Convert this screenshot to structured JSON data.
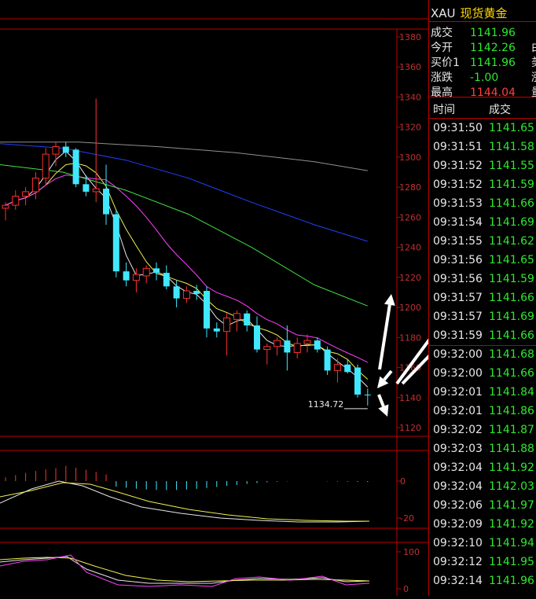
{
  "header": {
    "symbol": "XAU",
    "name": "现货黄金"
  },
  "quote": [
    {
      "label": "成交",
      "value": "1141.96",
      "color": "#2ee82e"
    },
    {
      "label": "今开",
      "value": "1142.26",
      "color": "#2ee82e",
      "cut": "由"
    },
    {
      "label": "买价1",
      "value": "1141.96",
      "color": "#2ee82e",
      "cut": "美"
    },
    {
      "label": "涨跌",
      "value": "-1.00",
      "color": "#2ee82e",
      "cut": "涨"
    },
    {
      "label": "最高",
      "value": "1144.04",
      "color": "#ff4040",
      "cut": "量"
    }
  ],
  "ticks_header": {
    "time": "时间",
    "price": "成交"
  },
  "ticks": [
    {
      "time": "09:31:50",
      "price": "1141.65"
    },
    {
      "time": "09:31:51",
      "price": "1141.58"
    },
    {
      "time": "09:31:52",
      "price": "1141.55"
    },
    {
      "time": "09:31:52",
      "price": "1141.59"
    },
    {
      "time": "09:31:53",
      "price": "1141.66"
    },
    {
      "time": "09:31:54",
      "price": "1141.69"
    },
    {
      "time": "09:31:55",
      "price": "1141.62"
    },
    {
      "time": "09:31:56",
      "price": "1141.65"
    },
    {
      "time": "09:31:56",
      "price": "1141.59"
    },
    {
      "time": "09:31:57",
      "price": "1141.66"
    },
    {
      "time": "09:31:57",
      "price": "1141.69"
    },
    {
      "time": "09:31:59",
      "price": "1141.66"
    },
    {
      "time": "09:32:00",
      "price": "1141.68"
    },
    {
      "time": "09:32:00",
      "price": "1141.66"
    },
    {
      "time": "09:32:01",
      "price": "1141.84"
    },
    {
      "time": "09:32:01",
      "price": "1141.86"
    },
    {
      "time": "09:32:02",
      "price": "1141.87"
    },
    {
      "time": "09:32:03",
      "price": "1141.88"
    },
    {
      "time": "09:32:04",
      "price": "1141.92"
    },
    {
      "time": "09:32:04",
      "price": "1142.03"
    },
    {
      "time": "09:32:06",
      "price": "1141.97"
    },
    {
      "time": "09:32:09",
      "price": "1141.92"
    },
    {
      "time": "09:32:10",
      "price": "1141.94"
    },
    {
      "time": "09:32:12",
      "price": "1141.95"
    },
    {
      "time": "09:32:14",
      "price": "1141.96"
    }
  ],
  "colors": {
    "up": "#ff3030",
    "down": "#40e8ff",
    "grid": "#c00000",
    "axis_text": "#c03030",
    "tick_price": "#2ee82e",
    "ma1": "#e8e8e8",
    "ma2": "#f0f050",
    "ma3": "#ff40ff",
    "ma4": "#40e040",
    "ma5": "#2040ff",
    "ma6": "#909090"
  },
  "chart_data": [
    {
      "type": "candlestick",
      "yticks": [
        1120,
        1140,
        1160,
        1180,
        1200,
        1220,
        1240,
        1260,
        1280,
        1300,
        1320,
        1340,
        1360,
        1380
      ],
      "ylim": [
        1116,
        1384
      ],
      "annotation": "1134.72",
      "candles": [
        {
          "o": 1266,
          "h": 1270,
          "l": 1258,
          "c": 1268
        },
        {
          "o": 1268,
          "h": 1278,
          "l": 1265,
          "c": 1274
        },
        {
          "o": 1274,
          "h": 1280,
          "l": 1268,
          "c": 1277
        },
        {
          "o": 1277,
          "h": 1290,
          "l": 1272,
          "c": 1286
        },
        {
          "o": 1286,
          "h": 1306,
          "l": 1282,
          "c": 1302
        },
        {
          "o": 1302,
          "h": 1310,
          "l": 1294,
          "c": 1307
        },
        {
          "o": 1307,
          "h": 1310,
          "l": 1300,
          "c": 1303
        },
        {
          "o": 1305,
          "h": 1306,
          "l": 1280,
          "c": 1282
        },
        {
          "o": 1282,
          "h": 1288,
          "l": 1274,
          "c": 1277
        },
        {
          "o": 1277,
          "h": 1339,
          "l": 1270,
          "c": 1279
        },
        {
          "o": 1279,
          "h": 1295,
          "l": 1255,
          "c": 1262
        },
        {
          "o": 1262,
          "h": 1265,
          "l": 1220,
          "c": 1224
        },
        {
          "o": 1224,
          "h": 1230,
          "l": 1214,
          "c": 1218
        },
        {
          "o": 1218,
          "h": 1226,
          "l": 1210,
          "c": 1222
        },
        {
          "o": 1221,
          "h": 1228,
          "l": 1216,
          "c": 1226
        },
        {
          "o": 1226,
          "h": 1230,
          "l": 1218,
          "c": 1223
        },
        {
          "o": 1223,
          "h": 1228,
          "l": 1212,
          "c": 1214
        },
        {
          "o": 1214,
          "h": 1218,
          "l": 1200,
          "c": 1206
        },
        {
          "o": 1206,
          "h": 1214,
          "l": 1203,
          "c": 1211
        },
        {
          "o": 1211,
          "h": 1215,
          "l": 1205,
          "c": 1209
        },
        {
          "o": 1211,
          "h": 1214,
          "l": 1180,
          "c": 1186
        },
        {
          "o": 1186,
          "h": 1190,
          "l": 1180,
          "c": 1184
        },
        {
          "o": 1184,
          "h": 1196,
          "l": 1168,
          "c": 1193
        },
        {
          "o": 1192,
          "h": 1198,
          "l": 1184,
          "c": 1196
        },
        {
          "o": 1196,
          "h": 1198,
          "l": 1184,
          "c": 1188
        },
        {
          "o": 1188,
          "h": 1194,
          "l": 1170,
          "c": 1172
        },
        {
          "o": 1172,
          "h": 1176,
          "l": 1162,
          "c": 1174
        },
        {
          "o": 1174,
          "h": 1180,
          "l": 1168,
          "c": 1178
        },
        {
          "o": 1178,
          "h": 1188,
          "l": 1158,
          "c": 1170
        },
        {
          "o": 1170,
          "h": 1180,
          "l": 1166,
          "c": 1176
        },
        {
          "o": 1176,
          "h": 1182,
          "l": 1170,
          "c": 1178
        },
        {
          "o": 1178,
          "h": 1180,
          "l": 1170,
          "c": 1172
        },
        {
          "o": 1172,
          "h": 1174,
          "l": 1155,
          "c": 1158
        },
        {
          "o": 1158,
          "h": 1166,
          "l": 1150,
          "c": 1162
        },
        {
          "o": 1162,
          "h": 1165,
          "l": 1156,
          "c": 1157
        },
        {
          "o": 1160,
          "h": 1162,
          "l": 1140,
          "c": 1142
        },
        {
          "o": 1142,
          "h": 1146,
          "l": 1134.72,
          "c": 1141.96
        }
      ]
    },
    {
      "type": "bar",
      "yticks": [
        0,
        -20
      ],
      "ylim": [
        -29,
        15
      ]
    },
    {
      "type": "line",
      "yticks": [
        100,
        0
      ],
      "ylim": [
        -8,
        115
      ]
    }
  ]
}
